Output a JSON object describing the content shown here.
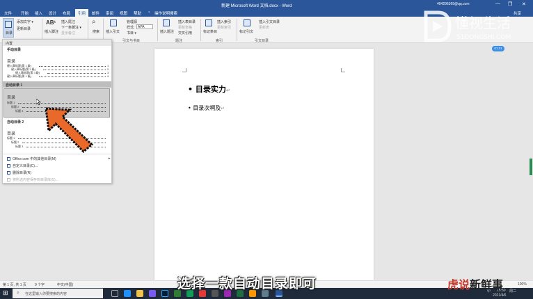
{
  "titlebar": {
    "doc_title": "新建 Microsoft Word 文档.docx - Word",
    "account": "404296369@qq.com",
    "minimize": "—",
    "restore": "❐",
    "close": "✕"
  },
  "tabs": [
    {
      "label": "文件"
    },
    {
      "label": "开始"
    },
    {
      "label": "插入"
    },
    {
      "label": "设计"
    },
    {
      "label": "布局"
    },
    {
      "label": "引用"
    },
    {
      "label": "邮件"
    },
    {
      "label": "审阅"
    },
    {
      "label": "视图"
    },
    {
      "label": "帮助"
    },
    {
      "label": "操作说明搜索"
    },
    {
      "label": "共享"
    }
  ],
  "ribbon": {
    "toc_button": "目录",
    "add_text": "添加文字 ▾",
    "update_toc": "更新目录",
    "insert_footnote": "插入脚注",
    "insert_endnote": "插入尾注",
    "next_footnote": "下一条脚注 ▾",
    "show_notes": "显示备注",
    "search": "搜索",
    "insert_citation": "插入引文",
    "manage_sources": "管理源",
    "style_label": "样式:",
    "style_value": "APA",
    "bibliography": "书目 ▾",
    "insert_caption": "插入题注",
    "insert_table_figures": "插入表目录",
    "update_table": "更新表格",
    "cross_reference": "交叉引用",
    "mark_entry": "标记条目",
    "insert_index": "插入索引",
    "update_index": "更新索引",
    "mark_citation": "标记引文",
    "insert_toa": "插入引文目录",
    "update_toa": "更新表",
    "group_citations": "引文与书目",
    "group_captions": "题注",
    "group_index": "索引",
    "group_toa": "引文目录"
  },
  "gallery": {
    "builtin_header": "内置",
    "manual_title": "手动目录",
    "manual_toc_heading": "目录",
    "manual_lines": [
      "键入章标题(第 1 级)",
      "键入章标题(第 2 级)",
      "键入章标题(第 3 级)",
      "键入章标题(第 1 级)"
    ],
    "manual_pages": [
      "1",
      "2",
      "3",
      "4"
    ],
    "auto1_title": "自动目录 1",
    "auto1_heading": "目录",
    "auto1_lines": [
      "标题 1",
      "标题 2",
      "标题 3"
    ],
    "auto2_title": "自动目录 2",
    "auto2_heading": "目录",
    "auto2_lines": [
      "标题 1",
      "标题 2",
      "标题 3"
    ],
    "menu": [
      {
        "label": "Office.com 中的其他目录(M)",
        "disabled": false
      },
      {
        "label": "自定义目录(C)...",
        "disabled": false
      },
      {
        "label": "删除目录(R)",
        "disabled": false
      },
      {
        "label": "将所选内容保存到目录库(S)...",
        "disabled": true
      }
    ]
  },
  "document": {
    "heading": "目录实力",
    "body": "目录次啊及",
    "para_mark": "↵"
  },
  "status": {
    "page": "第 1 页, 共 1 页",
    "words": "9 个字",
    "lang": "中文(中国)",
    "zoom": "100%"
  },
  "taskbar": {
    "search_placeholder": "在这里输入你要搜索的内容",
    "time": "15:50",
    "date": "2021/4/6",
    "lang": "中",
    "weekday": "周二"
  },
  "overlay": {
    "caption": "选择一款自动目录即可",
    "brand_red": "虎说",
    "brand_black": "新鲜事",
    "logo_cn": "懂视生活",
    "logo_en": "51DONGSHI.COM",
    "time_bubble": "01:21"
  },
  "colors": {
    "word_blue": "#2b579a",
    "arrow_orange": "#e8692a"
  }
}
